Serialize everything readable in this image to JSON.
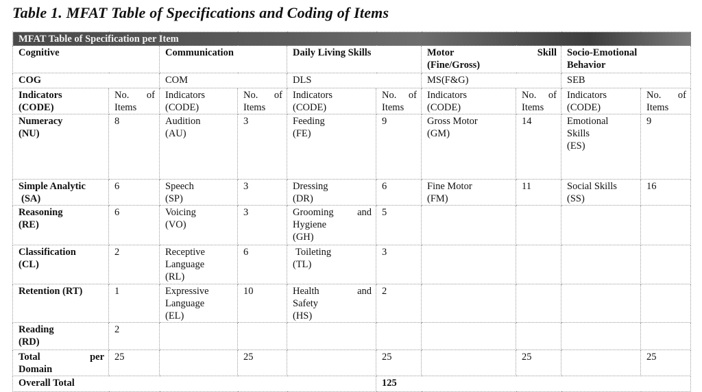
{
  "caption": "Table 1. MFAT Table of Specifications and Coding of Items",
  "banner": "MFAT Table of Specification per Item",
  "domains": [
    {
      "name": "Cognitive",
      "code": "COG"
    },
    {
      "name": "Communication",
      "code": "COM"
    },
    {
      "name": "Daily Living Skills",
      "code": "DLS"
    },
    {
      "name_left": "Motor",
      "name_right": "Skill",
      "name_line2": "(Fine/Gross)",
      "code": "MS(F&G)"
    },
    {
      "name_line1": "Socio-Emotional",
      "name_line2": "Behavior",
      "code": "SEB"
    }
  ],
  "subheaders": {
    "indicators_line1": "Indicators",
    "indicators_line2": "(CODE)",
    "items_left": "No.",
    "items_right": "of",
    "items_line2": "Items"
  },
  "rows": {
    "nu": {
      "cog": [
        "Numeracy",
        "(NU)"
      ],
      "cog_n": "8",
      "com": [
        "Audition",
        "(AU)"
      ],
      "com_n": "3",
      "dls": [
        "Feeding",
        "(FE)"
      ],
      "dls_n": "9",
      "ms": [
        "Gross Motor",
        "(GM)"
      ],
      "ms_n": "14",
      "seb": [
        "Emotional",
        "Skills",
        "(ES)"
      ],
      "seb_n": "9"
    },
    "sa": {
      "cog": [
        "Simple Analytic",
        " (SA)"
      ],
      "cog_n": "6",
      "com": [
        "Speech",
        "(SP)"
      ],
      "com_n": "3",
      "dls": [
        "Dressing",
        "(DR)"
      ],
      "dls_n": "6",
      "ms": [
        "Fine Motor",
        "(FM)"
      ],
      "ms_n": "11",
      "seb": [
        "Social Skills",
        "(SS)"
      ],
      "seb_n": "16"
    },
    "re": {
      "cog": [
        "Reasoning",
        "(RE)"
      ],
      "cog_n": "6",
      "com": [
        "Voicing",
        "(VO)"
      ],
      "com_n": "3",
      "dls_l": "Grooming",
      "dls_r": "and",
      "dls": [
        "Hygiene",
        "(GH)"
      ],
      "dls_n": "5"
    },
    "cl": {
      "cog": [
        "Classification",
        "(CL)"
      ],
      "cog_n": "2",
      "com": [
        "Receptive",
        "Language",
        "(RL)"
      ],
      "com_n": "6",
      "dls": [
        " Toileting",
        "(TL)"
      ],
      "dls_n": "3"
    },
    "rt": {
      "cog": [
        "Retention (RT)"
      ],
      "cog_n": "1",
      "com": [
        "Expressive",
        "Language",
        "(EL)"
      ],
      "com_n": "10",
      "dls_l": "Health",
      "dls_r": "and",
      "dls": [
        "Safety",
        "(HS)"
      ],
      "dls_n": "2"
    },
    "rd": {
      "cog": [
        "Reading",
        "(RD)"
      ],
      "cog_n": "2"
    }
  },
  "total": {
    "label_left": "Total",
    "label_right": "per",
    "label_line2": "Domain",
    "cog": "25",
    "com": "25",
    "dls": "25",
    "ms": "25",
    "seb": "25"
  },
  "overall": {
    "label": "Overall Total",
    "value": "125"
  }
}
